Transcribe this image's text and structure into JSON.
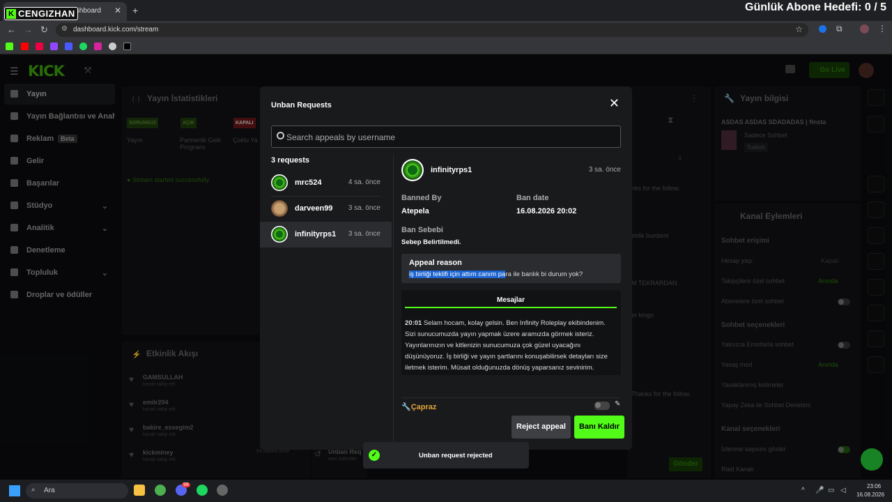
{
  "browser": {
    "tab_title": "Dashboard",
    "brand": "CENGIZHAN",
    "brand_icon": "K",
    "url": "dashboard.kick.com/stream",
    "overlay_goal": "Günlük Abone Hedefi: 0 / 5"
  },
  "header": {
    "logo": "KICK",
    "go_live": "Go Live"
  },
  "sidebar": {
    "items": [
      {
        "label": "Yayın"
      },
      {
        "label": "Yayın Bağlantısı ve Anahtar"
      },
      {
        "label": "Reklam",
        "badge": "Beta"
      },
      {
        "label": "Gelir"
      },
      {
        "label": "Başarılar"
      },
      {
        "label": "Stüdyo"
      },
      {
        "label": "Analitik"
      },
      {
        "label": "Denetleme"
      },
      {
        "label": "Topluluk"
      },
      {
        "label": "Droplar ve ödüller"
      }
    ]
  },
  "stats": {
    "title": "Yayın İstatistikleri",
    "badges": [
      "SORUNSUZ",
      "AÇIK",
      "KAPALI"
    ],
    "cols": [
      "Yayın",
      "Partnerlik Gelir Programı",
      "Çoklu Ya"
    ],
    "status": "Stream started successfully."
  },
  "activity": {
    "title": "Etkinlik Akışı",
    "items": [
      {
        "name": "GAMSULLAH",
        "sub": "kanalı takip etti"
      },
      {
        "name": "emilr204",
        "sub": "kanalı takip etti"
      },
      {
        "name": "bakire_essegim2",
        "sub": "kanalı takip etti"
      },
      {
        "name": "kickminey",
        "sub": "kanalı takip etti",
        "time": "54 dakika önce"
      }
    ],
    "unban_item": "Unban Req",
    "unban_sub": "was submitte"
  },
  "chat_bg": {
    "lines": [
      "nks for the follow.",
      "eldik burdami",
      "M TEKRARDAN",
      "er kingo",
      "Thanks for the follow."
    ],
    "send": "Gönder"
  },
  "right": {
    "title": "Yayın bilgisi",
    "stream_title": "ASDAS ASDAS SDADADAS | finsta",
    "category": "Sadece Sohbet",
    "lang": "Turkish",
    "actions_title": "Kanal Eylemleri",
    "chat_access": "Sohbet erişimi",
    "account_age": "Hesap yaşı",
    "account_age_val": "Kapalı",
    "followers_only": "Takipçilere özel sohbet",
    "followers_only_val": "Anında",
    "subs_only": "Abonelere özel sohbet",
    "chat_options": "Sohbet seçenekleri",
    "emote_only": "Yalnızca Emotlarla sohbet",
    "slow_mode": "Yavaş mod",
    "slow_mode_val": "Anında",
    "banned_words": "Yasaklanmış kelimeler",
    "ai_mod": "Yapay Zeka ile Sohbet Denetimi",
    "channel_options": "Kanal seçenekleri",
    "show_viewers": "İzlenme sayısını göster",
    "raid": "Raid Kanalı"
  },
  "modal": {
    "title": "Unban Requests",
    "search_placeholder": "Search appeals by username",
    "count": "3 requests",
    "requests": [
      {
        "name": "mrc524",
        "time": "4 sa. önce"
      },
      {
        "name": "darveen99",
        "time": "3 sa. önce"
      },
      {
        "name": "infinityrps1",
        "time": "3 sa. önce"
      }
    ],
    "detail": {
      "name": "infinityrps1",
      "time": "3 sa. önce",
      "banned_by_label": "Banned By",
      "banned_by": "Atepela",
      "ban_date_label": "Ban date",
      "ban_date": "16.08.2026 20:02",
      "reason_label": "Ban Sebebi",
      "reason": "Sebep Belirtilmedi.",
      "appeal_label": "Appeal reason",
      "appeal_highlight": "iş birliği teklifi için attım canım pa",
      "appeal_rest": "ra ile banlık bi durum yok?",
      "messages_tab": "Mesajlar",
      "msg_time": "20:01",
      "msg_text": "Selam hocam, kolay gelsin. Ben Infinity Roleplay ekibindenim. Sizi sunucumuzda yayın yapmak üzere aramızda görmek isteriz. Yayınlarınızın ve kitlenizin sunucumuza çok güzel uyacağını düşünüyoruz. İş birliği ve yayın şartlarını konuşabilirsek detayları size iletmek isterim. Müsait olduğunuzda dönüş yaparsanız sevinirim.",
      "mod_note": "Çapraz",
      "reject": "Reject appeal",
      "unban": "Banı Kaldır"
    }
  },
  "toast": {
    "text": "Unban request rejected"
  },
  "taskbar": {
    "search": "Ara",
    "time": "23:06",
    "date": "16.08.2026",
    "badge": "99"
  },
  "colors": {
    "accent": "#53fc18",
    "highlight": "#1c64d1"
  }
}
